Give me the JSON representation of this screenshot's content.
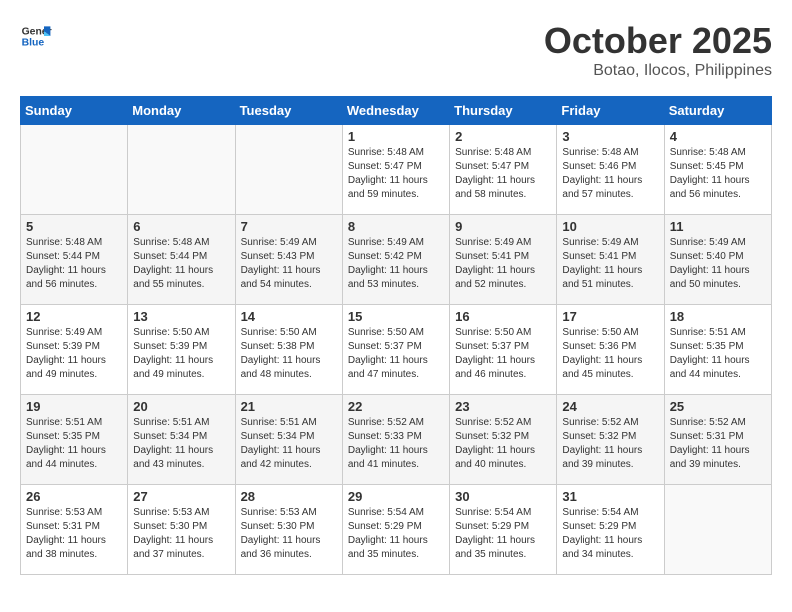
{
  "logo": {
    "line1": "General",
    "line2": "Blue"
  },
  "title": "October 2025",
  "location": "Botao, Ilocos, Philippines",
  "days_of_week": [
    "Sunday",
    "Monday",
    "Tuesday",
    "Wednesday",
    "Thursday",
    "Friday",
    "Saturday"
  ],
  "weeks": [
    [
      {
        "day": "",
        "info": ""
      },
      {
        "day": "",
        "info": ""
      },
      {
        "day": "",
        "info": ""
      },
      {
        "day": "1",
        "info": "Sunrise: 5:48 AM\nSunset: 5:47 PM\nDaylight: 11 hours\nand 59 minutes."
      },
      {
        "day": "2",
        "info": "Sunrise: 5:48 AM\nSunset: 5:47 PM\nDaylight: 11 hours\nand 58 minutes."
      },
      {
        "day": "3",
        "info": "Sunrise: 5:48 AM\nSunset: 5:46 PM\nDaylight: 11 hours\nand 57 minutes."
      },
      {
        "day": "4",
        "info": "Sunrise: 5:48 AM\nSunset: 5:45 PM\nDaylight: 11 hours\nand 56 minutes."
      }
    ],
    [
      {
        "day": "5",
        "info": "Sunrise: 5:48 AM\nSunset: 5:44 PM\nDaylight: 11 hours\nand 56 minutes."
      },
      {
        "day": "6",
        "info": "Sunrise: 5:48 AM\nSunset: 5:44 PM\nDaylight: 11 hours\nand 55 minutes."
      },
      {
        "day": "7",
        "info": "Sunrise: 5:49 AM\nSunset: 5:43 PM\nDaylight: 11 hours\nand 54 minutes."
      },
      {
        "day": "8",
        "info": "Sunrise: 5:49 AM\nSunset: 5:42 PM\nDaylight: 11 hours\nand 53 minutes."
      },
      {
        "day": "9",
        "info": "Sunrise: 5:49 AM\nSunset: 5:41 PM\nDaylight: 11 hours\nand 52 minutes."
      },
      {
        "day": "10",
        "info": "Sunrise: 5:49 AM\nSunset: 5:41 PM\nDaylight: 11 hours\nand 51 minutes."
      },
      {
        "day": "11",
        "info": "Sunrise: 5:49 AM\nSunset: 5:40 PM\nDaylight: 11 hours\nand 50 minutes."
      }
    ],
    [
      {
        "day": "12",
        "info": "Sunrise: 5:49 AM\nSunset: 5:39 PM\nDaylight: 11 hours\nand 49 minutes."
      },
      {
        "day": "13",
        "info": "Sunrise: 5:50 AM\nSunset: 5:39 PM\nDaylight: 11 hours\nand 49 minutes."
      },
      {
        "day": "14",
        "info": "Sunrise: 5:50 AM\nSunset: 5:38 PM\nDaylight: 11 hours\nand 48 minutes."
      },
      {
        "day": "15",
        "info": "Sunrise: 5:50 AM\nSunset: 5:37 PM\nDaylight: 11 hours\nand 47 minutes."
      },
      {
        "day": "16",
        "info": "Sunrise: 5:50 AM\nSunset: 5:37 PM\nDaylight: 11 hours\nand 46 minutes."
      },
      {
        "day": "17",
        "info": "Sunrise: 5:50 AM\nSunset: 5:36 PM\nDaylight: 11 hours\nand 45 minutes."
      },
      {
        "day": "18",
        "info": "Sunrise: 5:51 AM\nSunset: 5:35 PM\nDaylight: 11 hours\nand 44 minutes."
      }
    ],
    [
      {
        "day": "19",
        "info": "Sunrise: 5:51 AM\nSunset: 5:35 PM\nDaylight: 11 hours\nand 44 minutes."
      },
      {
        "day": "20",
        "info": "Sunrise: 5:51 AM\nSunset: 5:34 PM\nDaylight: 11 hours\nand 43 minutes."
      },
      {
        "day": "21",
        "info": "Sunrise: 5:51 AM\nSunset: 5:34 PM\nDaylight: 11 hours\nand 42 minutes."
      },
      {
        "day": "22",
        "info": "Sunrise: 5:52 AM\nSunset: 5:33 PM\nDaylight: 11 hours\nand 41 minutes."
      },
      {
        "day": "23",
        "info": "Sunrise: 5:52 AM\nSunset: 5:32 PM\nDaylight: 11 hours\nand 40 minutes."
      },
      {
        "day": "24",
        "info": "Sunrise: 5:52 AM\nSunset: 5:32 PM\nDaylight: 11 hours\nand 39 minutes."
      },
      {
        "day": "25",
        "info": "Sunrise: 5:52 AM\nSunset: 5:31 PM\nDaylight: 11 hours\nand 39 minutes."
      }
    ],
    [
      {
        "day": "26",
        "info": "Sunrise: 5:53 AM\nSunset: 5:31 PM\nDaylight: 11 hours\nand 38 minutes."
      },
      {
        "day": "27",
        "info": "Sunrise: 5:53 AM\nSunset: 5:30 PM\nDaylight: 11 hours\nand 37 minutes."
      },
      {
        "day": "28",
        "info": "Sunrise: 5:53 AM\nSunset: 5:30 PM\nDaylight: 11 hours\nand 36 minutes."
      },
      {
        "day": "29",
        "info": "Sunrise: 5:54 AM\nSunset: 5:29 PM\nDaylight: 11 hours\nand 35 minutes."
      },
      {
        "day": "30",
        "info": "Sunrise: 5:54 AM\nSunset: 5:29 PM\nDaylight: 11 hours\nand 35 minutes."
      },
      {
        "day": "31",
        "info": "Sunrise: 5:54 AM\nSunset: 5:29 PM\nDaylight: 11 hours\nand 34 minutes."
      },
      {
        "day": "",
        "info": ""
      }
    ]
  ]
}
